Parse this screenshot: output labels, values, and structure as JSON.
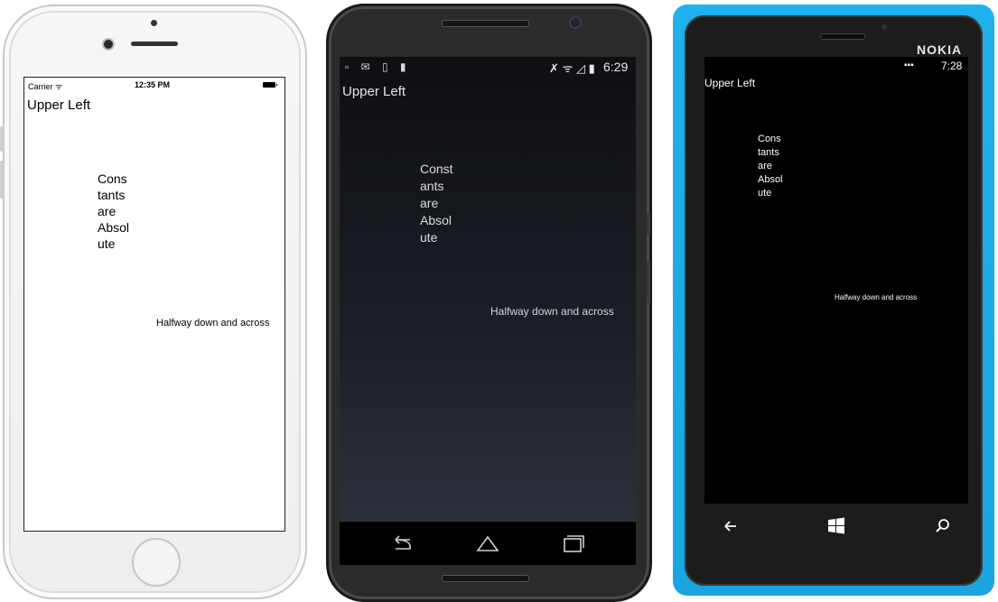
{
  "iphone": {
    "status": {
      "carrier": "Carrier ᯤ",
      "time": "12:35 PM"
    },
    "upper_left": "Upper Left",
    "constants_lines": [
      "Cons",
      "tants",
      "are",
      "Absol",
      "ute"
    ],
    "halfway": "Halfway down and across"
  },
  "android": {
    "status": {
      "left_icons": "▫ ✉ ▯ ▮",
      "right_icons": "✗ ᯤ ◿ ▮",
      "time": "6:29"
    },
    "upper_left": "Upper Left",
    "constants_lines": [
      "Const",
      "ants",
      "are",
      "Absol",
      "ute"
    ],
    "halfway": "Halfway down and across",
    "nav": [
      "back-icon",
      "home-icon",
      "recents-icon"
    ]
  },
  "nokia": {
    "brand": "NOKIA",
    "status": {
      "signal": "▪▪▪",
      "time": "7:28"
    },
    "upper_left": "Upper Left",
    "constants_lines": [
      "Cons",
      "tants",
      "are",
      "Absol",
      "ute"
    ],
    "halfway": "Halfway down and across",
    "nav": [
      "back-arrow-icon",
      "windows-start-icon",
      "search-icon"
    ]
  },
  "colors": {
    "nokia_body": "#1aa5e0",
    "android_body": "#2b2b2b",
    "iphone_body": "#f2f2f2"
  }
}
